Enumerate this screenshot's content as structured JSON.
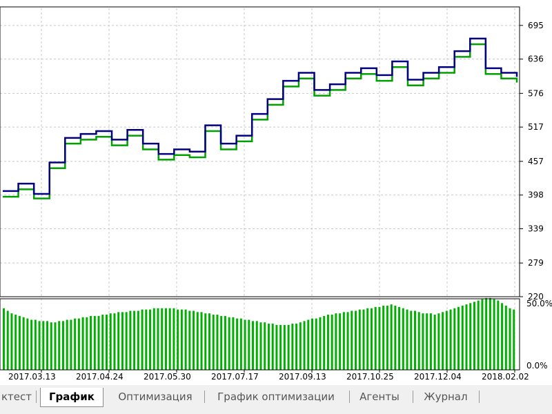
{
  "chart_data": [
    {
      "type": "line",
      "title": "",
      "y_ticks": [
        "695",
        "636",
        "576",
        "517",
        "457",
        "398",
        "339",
        "279",
        "220"
      ],
      "ylim": [
        220,
        725
      ],
      "grid": true,
      "series": [
        {
          "color": "#000080",
          "x": [
            0,
            3,
            6,
            9,
            12,
            15,
            18,
            21,
            24,
            27,
            30,
            33,
            36,
            39,
            42,
            45,
            48,
            51,
            54,
            57,
            60,
            63,
            66,
            69,
            72,
            75,
            78,
            81,
            84,
            87,
            90,
            93,
            96,
            99
          ],
          "values": [
            405,
            418,
            400,
            455,
            498,
            505,
            510,
            495,
            512,
            488,
            470,
            478,
            474,
            520,
            488,
            502,
            540,
            566,
            598,
            612,
            582,
            592,
            612,
            620,
            608,
            632,
            600,
            612,
            622,
            650,
            672,
            620,
            612,
            605
          ]
        },
        {
          "color": "#00a000",
          "x": [
            0,
            3,
            6,
            9,
            12,
            15,
            18,
            21,
            24,
            27,
            30,
            33,
            36,
            39,
            42,
            45,
            48,
            51,
            54,
            57,
            60,
            63,
            66,
            69,
            72,
            75,
            78,
            81,
            84,
            87,
            90,
            93,
            96,
            99
          ],
          "values": [
            395,
            408,
            392,
            445,
            488,
            495,
            500,
            485,
            502,
            478,
            460,
            468,
            464,
            510,
            478,
            492,
            530,
            556,
            588,
            602,
            572,
            582,
            602,
            610,
            598,
            622,
            590,
            602,
            612,
            640,
            662,
            610,
            602,
            595
          ]
        }
      ],
      "colors": {
        "background": "#ffffff",
        "grid": "#c8c8c8",
        "axis": "#000000"
      }
    },
    {
      "type": "bar",
      "title": "",
      "y_ticks": [
        "50.0%",
        "0.0%"
      ],
      "ylim": [
        0,
        50
      ],
      "x_ticks": [
        "2017.03.13",
        "2017.04.24",
        "2017.05.30",
        "2017.07.17",
        "2017.09.13",
        "2017.10.25",
        "2017.12.04",
        "2018.02.02"
      ],
      "values": [
        48,
        46,
        44,
        43,
        42,
        41,
        40,
        39,
        39,
        38,
        38,
        38,
        37,
        37,
        38,
        38,
        39,
        39,
        40,
        40,
        41,
        41,
        42,
        42,
        42,
        43,
        43,
        44,
        44,
        45,
        45,
        45,
        46,
        46,
        46,
        47,
        47,
        47,
        48,
        48,
        48,
        48,
        48,
        48,
        47,
        47,
        47,
        46,
        46,
        45,
        45,
        44,
        44,
        43,
        43,
        42,
        42,
        41,
        41,
        40,
        40,
        39,
        39,
        38,
        38,
        37,
        37,
        36,
        36,
        35,
        35,
        35,
        35,
        36,
        36,
        37,
        38,
        39,
        40,
        40,
        41,
        42,
        43,
        43,
        44,
        44,
        45,
        45,
        46,
        46,
        47,
        47,
        48,
        48,
        49,
        49,
        50,
        50,
        51,
        50,
        49,
        48,
        47,
        46,
        46,
        45,
        44,
        44,
        44,
        43,
        44,
        45,
        46,
        47,
        48,
        49,
        50,
        51,
        52,
        53,
        54,
        55,
        56,
        56,
        55,
        54,
        52,
        50,
        48,
        47
      ],
      "colors": {
        "bars": "#00b000"
      }
    }
  ],
  "tabs": [
    {
      "label": "ктест"
    },
    {
      "label": "График"
    },
    {
      "label": "Оптимизация"
    },
    {
      "label": "График оптимизации"
    },
    {
      "label": "Агенты"
    },
    {
      "label": "Журнал"
    }
  ],
  "active_tab": "График"
}
